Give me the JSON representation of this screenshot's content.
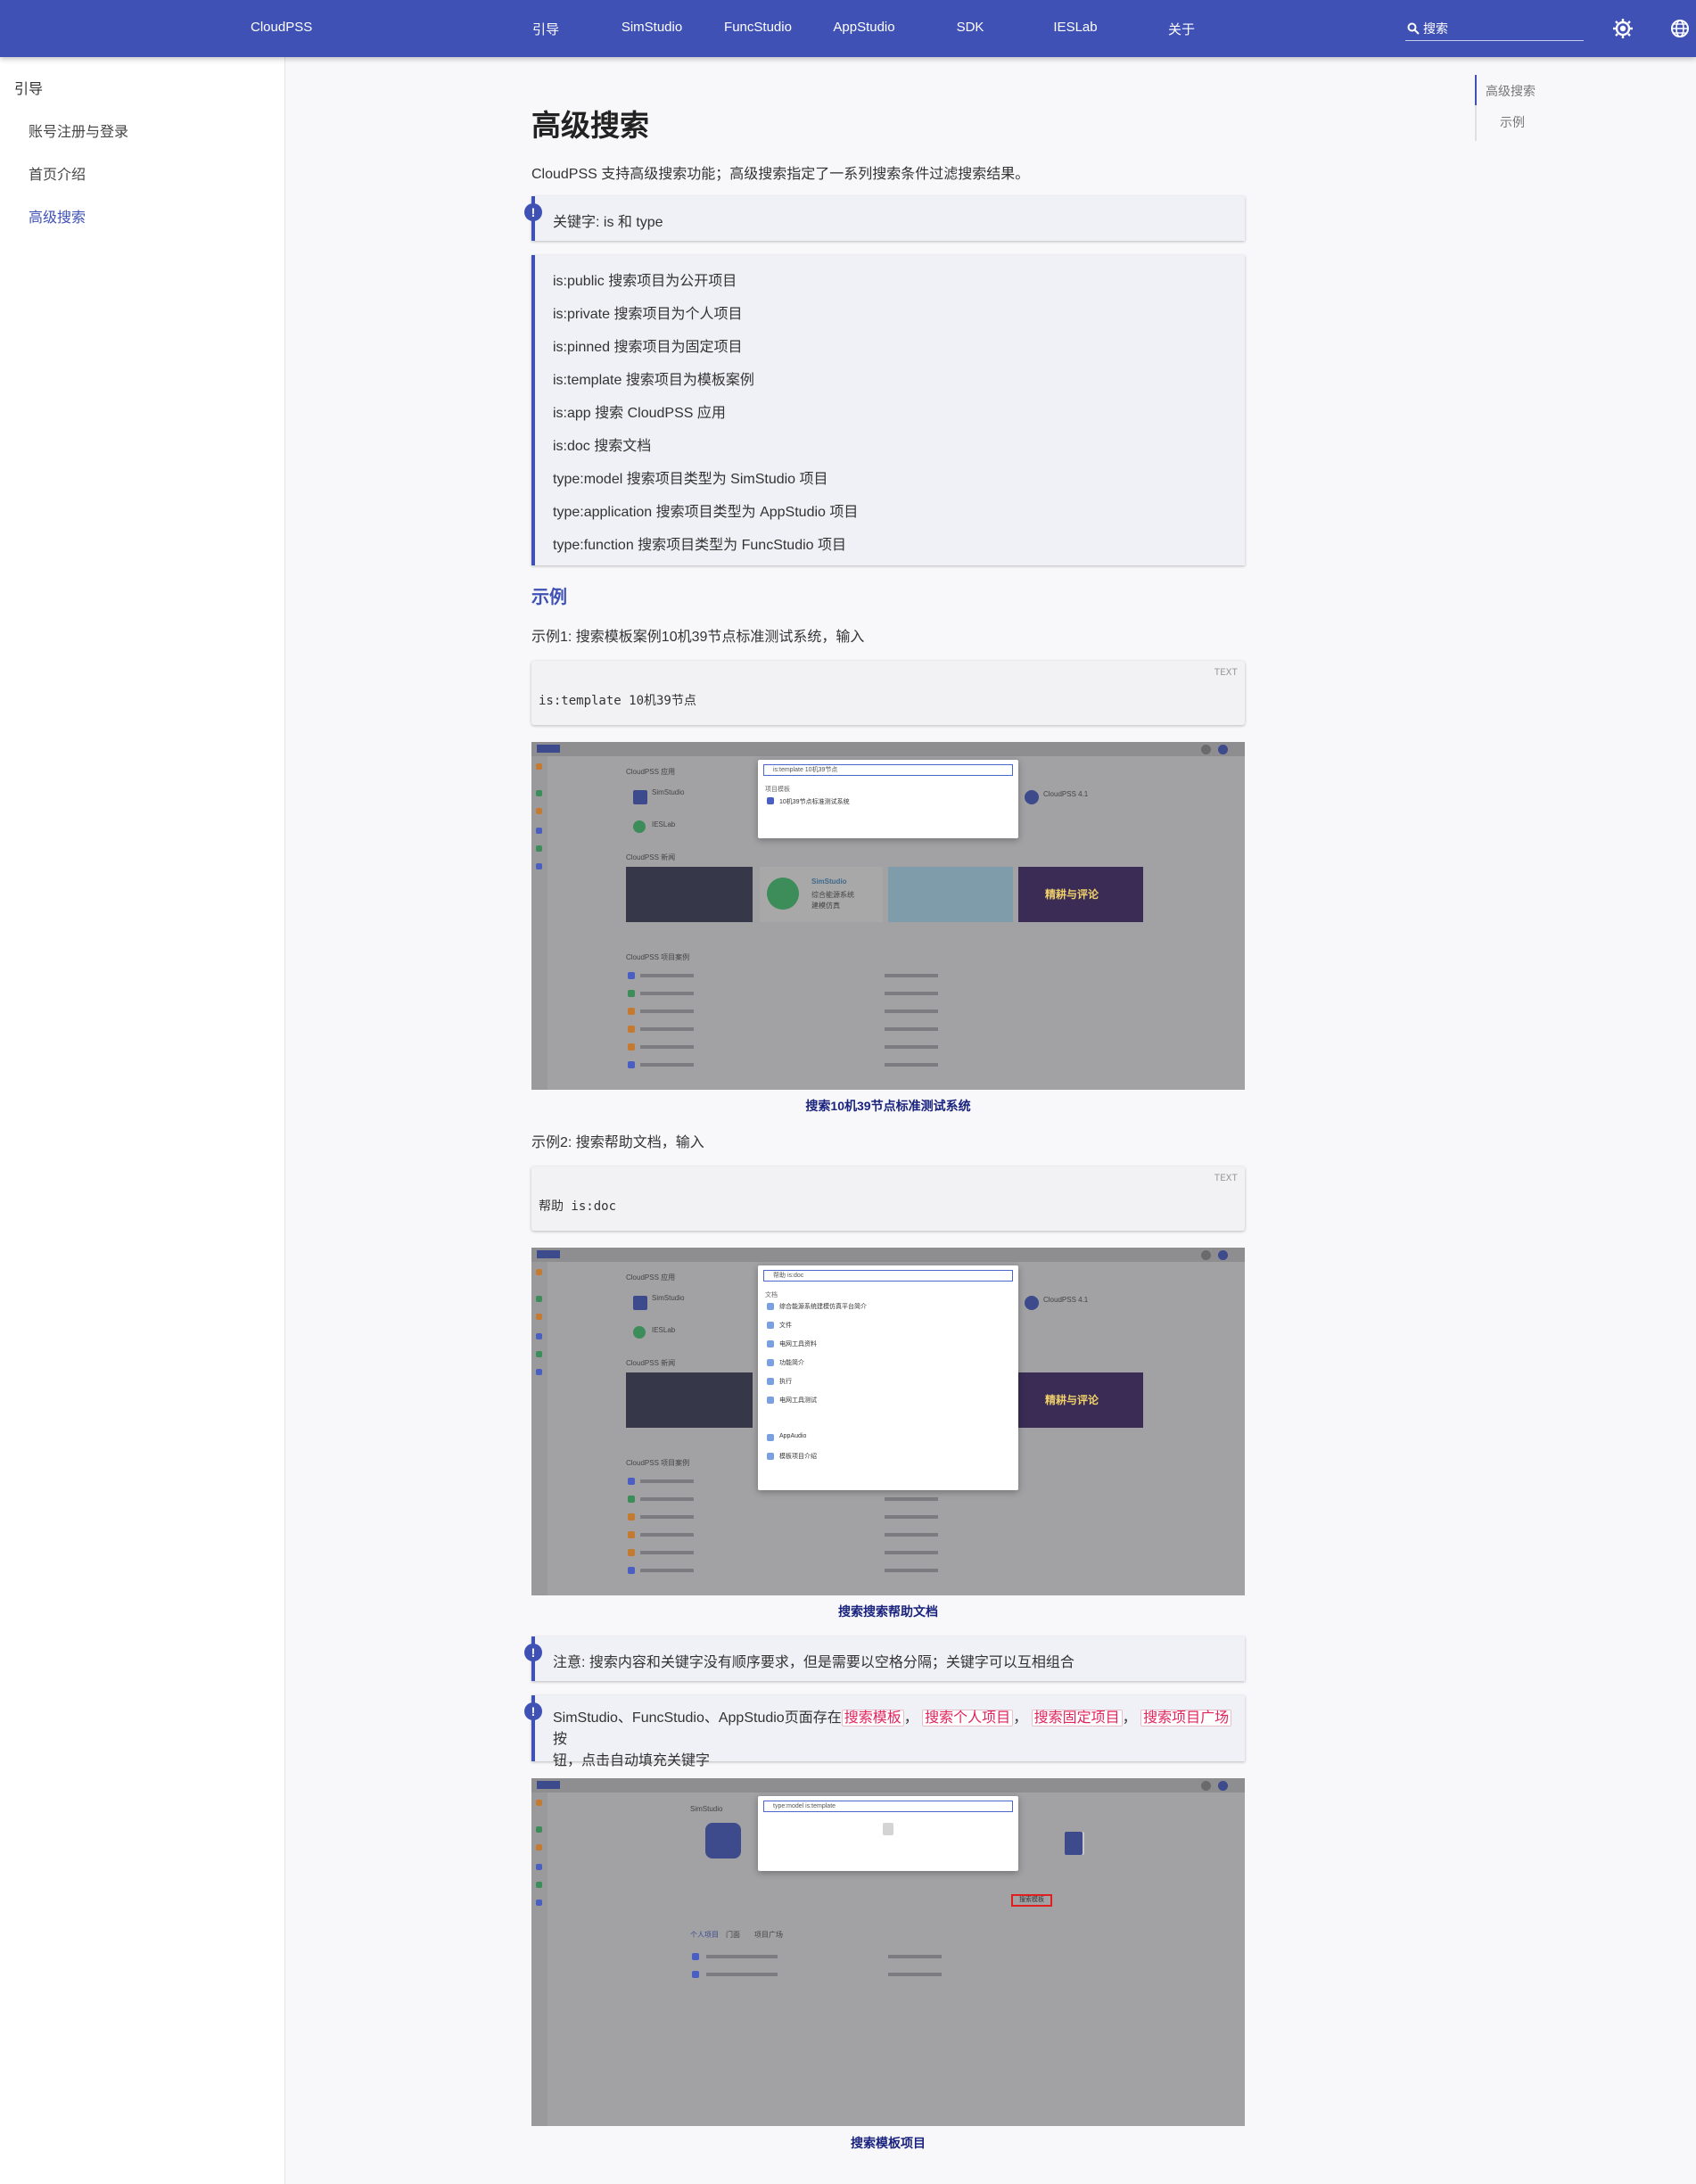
{
  "topbar": {
    "brand": "CloudPSS",
    "nav": [
      "引导",
      "SimStudio",
      "FuncStudio",
      "AppStudio",
      "SDK",
      "IESLab",
      "关于"
    ],
    "search_placeholder": "搜索"
  },
  "sidebar": {
    "root": "引导",
    "items": [
      "账号注册与登录",
      "首页介绍",
      "高级搜索"
    ]
  },
  "toc": [
    "高级搜索",
    "示例"
  ],
  "main": {
    "title": "高级搜索",
    "intro": "CloudPSS 支持高级搜索功能；高级搜索指定了一系列搜索条件过滤搜索结果。",
    "note_keywords": "关键字: is 和 type",
    "keywords": [
      "is:public 搜索项目为公开项目",
      "is:private 搜索项目为个人项目",
      "is:pinned 搜索项目为固定项目",
      "is:template 搜索项目为模板案例",
      "is:app 搜索 CloudPSS 应用",
      "is:doc 搜索文档",
      "type:model 搜索项目类型为 SimStudio 项目",
      "type:application 搜索项目类型为 AppStudio 项目",
      "type:function 搜索项目类型为 FuncStudio 项目"
    ],
    "example_heading": "示例",
    "example1_text": "示例1: 搜索模板案例10机39节点标准测试系统，输入",
    "code1_lang": "TEXT",
    "code1": "is:template 10机39节点",
    "caption1": "搜索10机39节点标准测试系统",
    "example2_text": "示例2: 搜索帮助文档，输入",
    "code2_lang": "TEXT",
    "code2": "帮助 is:doc",
    "caption2": "搜索搜索帮助文档",
    "note_order": "注意: 搜索内容和关键字没有顺序要求，但是需要以空格分隔；关键字可以互相组合",
    "note_buttons_prefix": "SimStudio、FuncStudio、AppStudio页面存在",
    "note_buttons_tags": [
      "搜索模板",
      "搜索个人项目",
      "搜索固定项目",
      "搜索项目广场"
    ],
    "note_buttons_suffix_1": "按",
    "note_buttons_suffix_2": "钮，点击自动填充关键字",
    "caption3": "搜索模板项目"
  },
  "screenshots": {
    "shot1_query": "is:template 10机39节点",
    "shot2_query": "帮助 is:doc",
    "shot3_query": "type:model is:template",
    "header_text": "CloudPSS",
    "section_apps": "CloudPSS 应用",
    "section_news": "CloudPSS 新闻",
    "section_recent": "CloudPSS 项目案例",
    "app_simstudio": "SimStudio",
    "app_ieslab": "IESLab",
    "app_cloudpss": "CloudPSS 4.1",
    "tile_text_1": "SimStudio",
    "tile_text_2": "综合能源系统",
    "tile_text_3": "建模仿真",
    "tile_banner": "精耕与评论",
    "modal1_group": "项目模板",
    "modal1_item": "10机39节点标准测试系统",
    "modal2_group": "文档",
    "modal2_items": [
      "综合能源系统建模仿真平台简介",
      "文件",
      "电网工具资料",
      "功能简介",
      "执行",
      "电网工具测试",
      "AppAudio",
      "模板项目介绍"
    ],
    "shot3_title": "SimStudio",
    "shot3_tabs": [
      "个人项目",
      "门面",
      "项目广场"
    ],
    "shot3_button": "搜索模板"
  },
  "colors": {
    "primary": "#3f51b5",
    "accent_tag": "#e0245e",
    "caption": "#1a237e"
  }
}
